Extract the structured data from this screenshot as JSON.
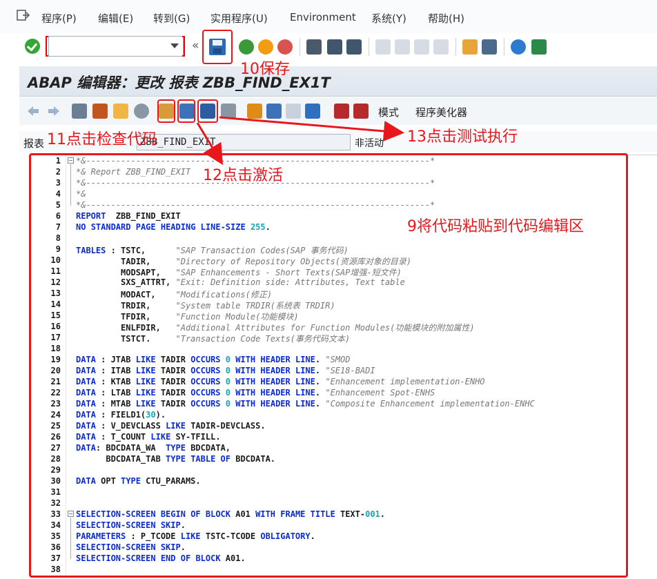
{
  "menu": [
    {
      "label": "程序(P)",
      "x": 0
    },
    {
      "label": "编辑(E)"
    },
    {
      "label": "转到(G)"
    },
    {
      "label": "实用程序(U)"
    },
    {
      "label": "Environment"
    },
    {
      "label": "系统(Y)"
    },
    {
      "label": "帮助(H)"
    }
  ],
  "title": "ABAP 编辑器：更改 报表 ZBB_FIND_EX1T",
  "app_toolbar": {
    "mode_label": "模式",
    "pretty_printer_label": "程序美化器"
  },
  "report": {
    "label": "报表",
    "value": "ZBB_FIND_EXIT",
    "status": "非活动"
  },
  "annotations": {
    "save": "10保存",
    "check": "11点击检查代码",
    "activate": "12点击激活",
    "test": "13点击测试执行",
    "paste": "9将代码粘贴到代码编辑区"
  },
  "colors": {
    "annotation": "#e8171b",
    "keyword": "#0b2bd6",
    "comment": "#777777"
  },
  "code_lines": [
    "*&---------------------------------------------------------------------*",
    "*& Report ZBB_FIND_EXIT",
    "*&---------------------------------------------------------------------*",
    "*&",
    "*&---------------------------------------------------------------------*",
    "REPORT  ZBB_FIND_EXIT",
    "NO STANDARD PAGE HEADING LINE-SIZE 255.",
    "",
    "TABLES : TSTC,      \"SAP Transaction Codes(SAP 事务代码)",
    "         TADIR,     \"Directory of Repository Objects(资源库对象的目录)",
    "         MODSAPT,   \"SAP Enhancements - Short Texts(SAP增强-短文件)",
    "         SXS_ATTRT, \"Exit: Definition side: Attributes, Text table",
    "         MODACT,    \"Modifications(修正)",
    "         TRDIR,     \"System table TRDIR(系统表 TRDIR)",
    "         TFDIR,     \"Function Module(功能模块)",
    "         ENLFDIR,   \"Additional Attributes for Function Modules(功能模块的附加属性)",
    "         TSTCT.     \"Transaction Code Texts(事务代码文本)",
    "",
    "DATA : JTAB LIKE TADIR OCCURS 0 WITH HEADER LINE. \"SMOD",
    "DATA : ITAB LIKE TADIR OCCURS 0 WITH HEADER LINE. \"SE18-BADI",
    "DATA : KTAB LIKE TADIR OCCURS 0 WITH HEADER LINE. \"Enhancement implementation-ENHO",
    "DATA : LTAB LIKE TADIR OCCURS 0 WITH HEADER LINE. \"Enhancement Spot-ENHS",
    "DATA : MTAB LIKE TADIR OCCURS 0 WITH HEADER LINE. \"Composite Enhancement implementation-ENHC",
    "DATA : FIELD1(30).",
    "DATA : V_DEVCLASS LIKE TADIR-DEVCLASS.",
    "DATA : T_COUNT LIKE SY-TFILL.",
    "DATA: BDCDATA_WA  TYPE BDCDATA,",
    "      BDCDATA_TAB TYPE TABLE OF BDCDATA.",
    "",
    "DATA OPT TYPE CTU_PARAMS.",
    "",
    "",
    "SELECTION-SCREEN BEGIN OF BLOCK A01 WITH FRAME TITLE TEXT-001.",
    "SELECTION-SCREEN SKIP.",
    "PARAMETERS : P_TCODE LIKE TSTC-TCODE OBLIGATORY.",
    "SELECTION-SCREEN SKIP.",
    "SELECTION-SCREEN END OF BLOCK A01.",
    ""
  ]
}
